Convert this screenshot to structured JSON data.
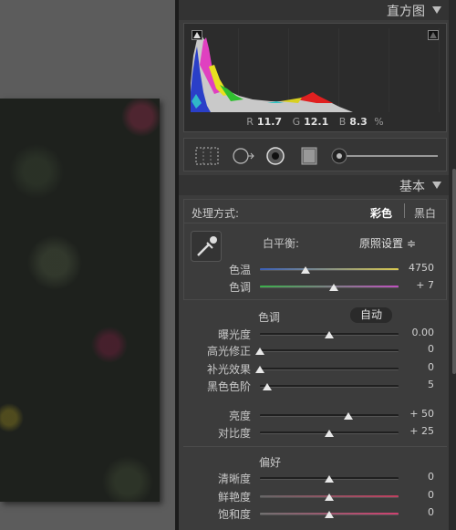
{
  "histogram_panel": {
    "title": "直方图",
    "r_label": "R",
    "r_value": "11.7",
    "g_label": "G",
    "g_value": "12.1",
    "b_label": "B",
    "b_value": "8.3",
    "unit": "%"
  },
  "basic_panel": {
    "title": "基本",
    "treatment_label": "处理方式:",
    "treatment_color": "彩色",
    "treatment_bw": "黑白",
    "wb_label": "白平衡:",
    "wb_value": "原照设置 ≑",
    "sliders_wb": [
      {
        "label": "色温",
        "value": "4750",
        "pos": 0.33
      },
      {
        "label": "色调",
        "value": "+ 7",
        "pos": 0.53
      }
    ],
    "tone_label": "色调",
    "auto_button": "自动",
    "sliders_tone": [
      {
        "label": "曝光度",
        "value": "0.00",
        "pos": 0.5
      },
      {
        "label": "高光修正",
        "value": "0",
        "pos": 0.0
      },
      {
        "label": "补光效果",
        "value": "0",
        "pos": 0.0
      },
      {
        "label": "黑色色阶",
        "value": "5",
        "pos": 0.05
      },
      {
        "label": "亮度",
        "value": "+ 50",
        "pos": 0.64
      },
      {
        "label": "对比度",
        "value": "+ 25",
        "pos": 0.5
      }
    ],
    "presence_label": "偏好",
    "sliders_presence": [
      {
        "label": "清晰度",
        "value": "0",
        "pos": 0.5
      },
      {
        "label": "鲜艳度",
        "value": "0",
        "pos": 0.5
      },
      {
        "label": "饱和度",
        "value": "0",
        "pos": 0.5
      }
    ]
  }
}
